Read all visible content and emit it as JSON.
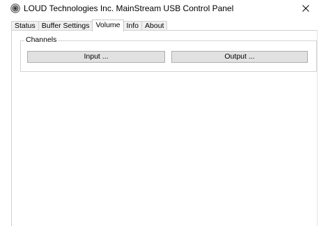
{
  "window": {
    "title": "LOUD Technologies Inc. MainStream USB Control Panel",
    "app_icon": "speaker-icon",
    "close_icon": "close-icon"
  },
  "tabs": [
    {
      "label": "Status",
      "active": false
    },
    {
      "label": "Buffer Settings",
      "active": false
    },
    {
      "label": "Volume",
      "active": true
    },
    {
      "label": "Info",
      "active": false
    },
    {
      "label": "About",
      "active": false
    }
  ],
  "channels": {
    "label": "Channels",
    "input_button": "Input ...",
    "output_button": "Output ..."
  },
  "colors": {
    "button_face": "#e1e1e1",
    "button_border": "#adadad",
    "tab_inactive": "#f0f0f0",
    "border": "#d0d0d0"
  }
}
